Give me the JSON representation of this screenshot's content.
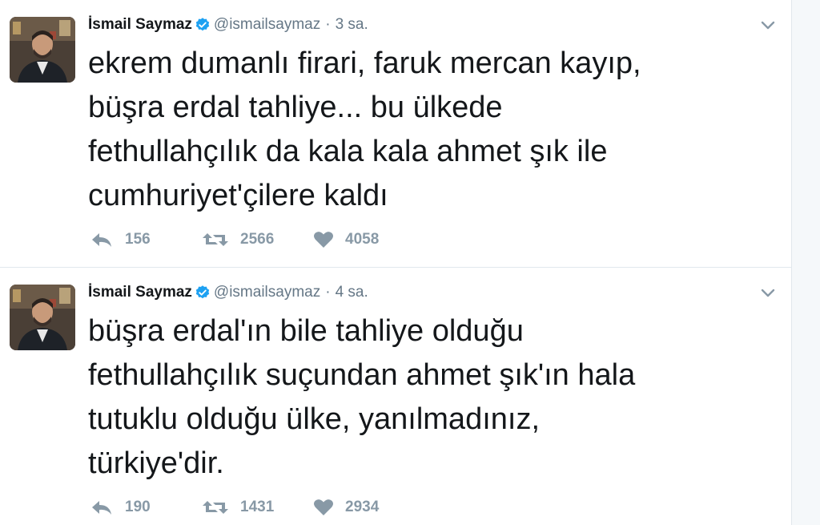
{
  "tweets": [
    {
      "display_name": "İsmail Saymaz",
      "screen_name": "@ismailsaymaz",
      "separator": "·",
      "time": "3 sa.",
      "text_lines": [
        "ekrem dumanlı firari, faruk mercan kayıp,",
        "büşra erdal tahliye... bu ülkede",
        "fethullahçılık da kala kala ahmet şık ile",
        "cumhuriyet'çilere kaldı"
      ],
      "replies": "156",
      "retweets": "2566",
      "likes": "4058"
    },
    {
      "display_name": "İsmail Saymaz",
      "screen_name": "@ismailsaymaz",
      "separator": "·",
      "time": "4 sa.",
      "text_lines": [
        "büşra erdal'ın bile tahliye olduğu",
        "fethullahçılık suçundan ahmet şık'ın hala",
        "tutuklu olduğu ülke, yanılmadınız,",
        "türkiye'dir."
      ],
      "replies": "190",
      "retweets": "1431",
      "likes": "2934"
    }
  ],
  "icons": {
    "verified": "verified-badge-icon",
    "menu": "chevron-down-icon",
    "reply": "reply-icon",
    "retweet": "retweet-icon",
    "like": "heart-icon"
  },
  "colors": {
    "verified": "#1da1f2",
    "text": "#14171a",
    "meta": "#657786",
    "actions": "#8899a6"
  }
}
